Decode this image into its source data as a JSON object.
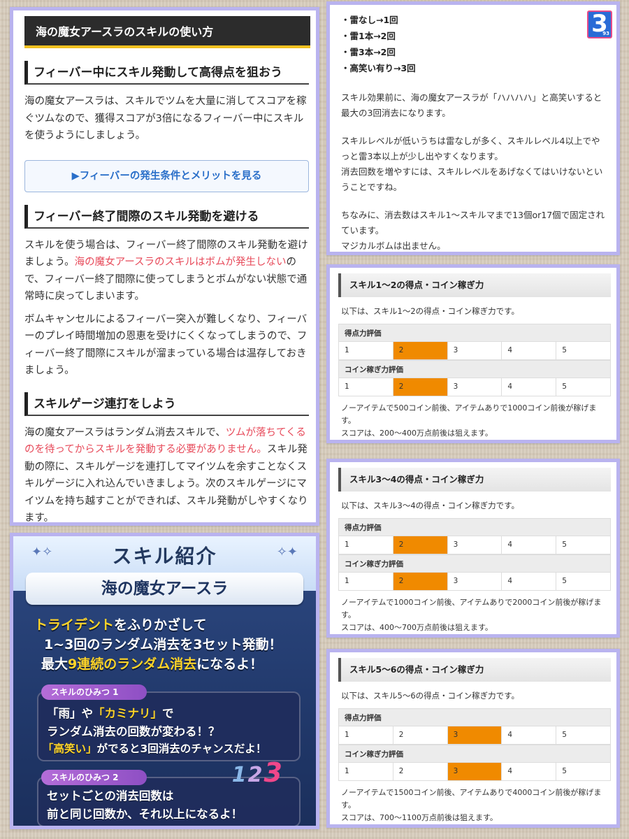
{
  "left": {
    "title": "海の魔女アースラのスキルの使い方",
    "sections": [
      {
        "heading": "フィーバー中にスキル発動して高得点を狙おう",
        "p1": "海の魔女アースラは、スキルでツムを大量に消してスコアを稼ぐツムなので、獲得スコアが3倍になるフィーバー中にスキルを使うようにしましょう。",
        "link": "▶フィーバーの発生条件とメリットを見る"
      },
      {
        "heading": "フィーバー終了間際のスキル発動を避ける",
        "p1_a": "スキルを使う場合は、フィーバー終了間際のスキル発動を避けましょう。",
        "p1_red": "海の魔女アースラのスキルはボムが発生しない",
        "p1_b": "ので、フィーバー終了間際に使ってしまうとボムがない状態で通常時に戻ってしまいます。",
        "p2": "ボムキャンセルによるフィーバー突入が難しくなり、フィーバーのプレイ時間増加の恩恵を受けにくくなってしまうので、フィーバー終了間際にスキルが溜まっている場合は温存しておきましょう。"
      },
      {
        "heading": "スキルゲージ連打をしよう",
        "p1_a": "海の魔女アースラはランダム消去スキルで、",
        "p1_red": "ツムが落ちてくるのを待ってからスキルを発動する必要がありません。",
        "p1_b": "スキル発動の際に、スキルゲージを連打してマイツムを余すことなくスキルゲージに入れ込んでいきましょう。次のスキルゲージにマイツムを持ち越すことができれば、スキル発動がしやすくなります。"
      }
    ]
  },
  "skill_image": {
    "banner": "スキル紹介",
    "name": "海の魔女アースラ",
    "line1_yel": "トライデント",
    "line1_rest": "をふりかざして",
    "line2": "1~3回のランダム消去を3セット発動！",
    "line3_a": "最大",
    "line3_yel": "9連続のランダム消去",
    "line3_b": "になるよ！",
    "secret1_tag": "スキルのひみつ 1",
    "secret1_l1_q1": "「雨」",
    "secret1_l1_mid": "や",
    "secret1_l1_q2": "「カミナリ」",
    "secret1_l1_end": "で",
    "secret1_l2": "ランダム消去の回数が変わる！？",
    "secret1_l3_yel": "「高笑い」",
    "secret1_l3_rest": "がでると3回消去のチャンスだよ！",
    "secret2_tag": "スキルのひみつ 2",
    "secret2_l1": "セットごとの消去回数は",
    "secret2_l2": "前と同じ回数か、それ以上になるよ！",
    "numbers": [
      "1",
      "2",
      "3"
    ]
  },
  "right_top": {
    "bullets": [
      "・雷なし→1回",
      "・雷1本→2回",
      "・雷3本→2回",
      "・高笑い有り→3回"
    ],
    "p1": "スキル効果前に、海の魔女アースラが「ハハハハ」と高笑いすると最大の3回消去になります。",
    "p2": "スキルレベルが低いうちは雷なしが多く、スキルレベル4以上でやっと雷3本以上が少し出やすくなります。",
    "p3": "消去回数を増やすには、スキルレベルをあげなくてはいけないということですね。",
    "p4": "ちなみに、消去数はスキル1～スキルマまで13個or17個で固定されています。",
    "p5": "マジカルボムは出ません。",
    "badge": "3",
    "badge_small": "93"
  },
  "score_cards": [
    {
      "heading": "スキル1～2の得点・コイン稼ぎ力",
      "intro": "以下は、スキル1～2の得点・コイン稼ぎ力です。",
      "score_label": "得点力評価",
      "coin_label": "コイン稼ぎ力評価",
      "levels": [
        "1",
        "2",
        "3",
        "4",
        "5"
      ],
      "score_rating": 2,
      "coin_rating": 2,
      "note1": "ノーアイテムで500コイン前後、アイテムありで1000コイン前後が稼げます。",
      "note2": "スコアは、200～400万点前後は狙えます。"
    },
    {
      "heading": "スキル3～4の得点・コイン稼ぎ力",
      "intro": "以下は、スキル3～4の得点・コイン稼ぎ力です。",
      "score_label": "得点力評価",
      "coin_label": "コイン稼ぎ力評価",
      "levels": [
        "1",
        "2",
        "3",
        "4",
        "5"
      ],
      "score_rating": 2,
      "coin_rating": 2,
      "note1": "ノーアイテムで1000コイン前後、アイテムありで2000コイン前後が稼げます。",
      "note2": "スコアは、400～700万点前後は狙えます。"
    },
    {
      "heading": "スキル5～6の得点・コイン稼ぎ力",
      "intro": "以下は、スキル5～6の得点・コイン稼ぎ力です。",
      "score_label": "得点力評価",
      "coin_label": "コイン稼ぎ力評価",
      "levels": [
        "1",
        "2",
        "3",
        "4",
        "5"
      ],
      "score_rating": 3,
      "coin_rating": 3,
      "note1": "ノーアイテムで1500コイン前後、アイテムありで4000コイン前後が稼げます。",
      "note2": "スコアは、700～1100万点前後は狙えます。"
    }
  ],
  "colors": {
    "card_border": "#b9b3ef",
    "rating_highlight": "#f08a00",
    "accent_red": "#e74a5a",
    "link_blue": "#2a6fc9"
  }
}
